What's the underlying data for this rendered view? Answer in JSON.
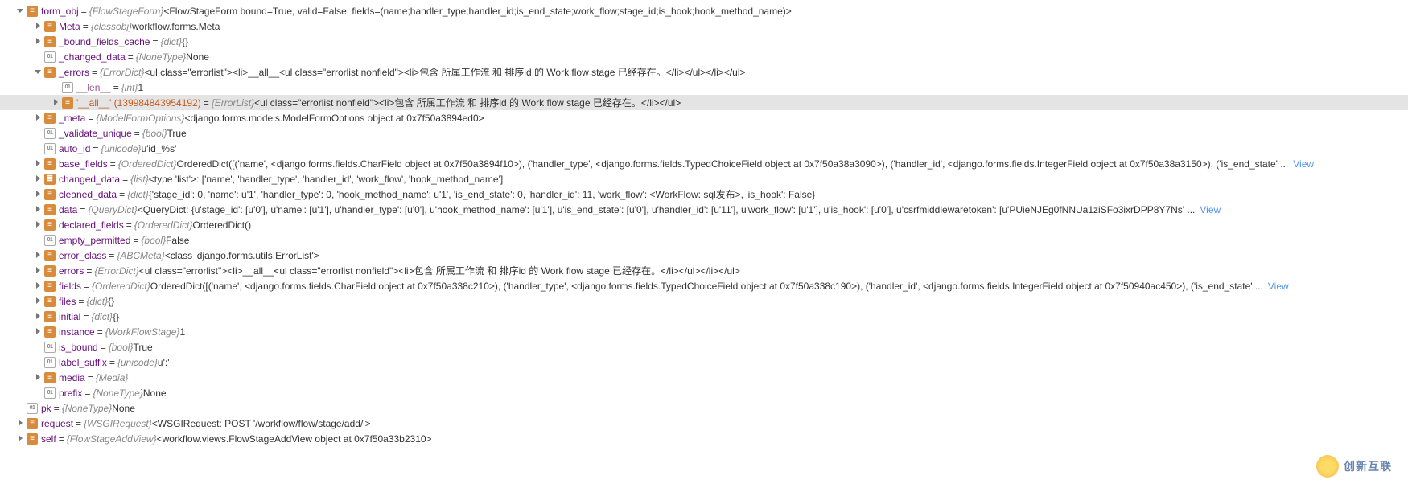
{
  "view_link": "View",
  "watermark": "创新互联",
  "rows": [
    {
      "indent": 0,
      "arrow": "exp",
      "icon": "obj",
      "nameClass": "name",
      "name": "form_obj",
      "type": "{FlowStageForm}",
      "val": "<FlowStageForm bound=True, valid=False, fields=(name;handler_type;handler_id;is_end_state;work_flow;stage_id;is_hook;hook_method_name)>"
    },
    {
      "indent": 1,
      "arrow": "col",
      "icon": "obj",
      "nameClass": "name",
      "name": "Meta",
      "type": "{classobj}",
      "val": "workflow.forms.Meta"
    },
    {
      "indent": 1,
      "arrow": "col",
      "icon": "obj",
      "nameClass": "name",
      "name": "_bound_fields_cache",
      "type": "{dict}",
      "val": "{}"
    },
    {
      "indent": 1,
      "arrow": "none",
      "icon": "box",
      "nameClass": "name",
      "name": "_changed_data",
      "type": "{NoneType}",
      "val": "None"
    },
    {
      "indent": 1,
      "arrow": "exp",
      "icon": "obj",
      "nameClass": "name",
      "name": "_errors",
      "type": "{ErrorDict}",
      "val": "<ul class=\"errorlist\"><li>__all__<ul class=\"errorlist nonfield\"><li>包含 所属工作流 和 排序id 的 Work flow stage 已经存在。</li></ul></li></ul>"
    },
    {
      "indent": 2,
      "arrow": "none",
      "icon": "box",
      "nameClass": "name special",
      "name": "__len__",
      "type": "{int}",
      "val": "1"
    },
    {
      "indent": 2,
      "arrow": "col",
      "icon": "obj",
      "nameClass": "name orange",
      "name": "'__all__' (139984843954192)",
      "type": "{ErrorList}",
      "val": "<ul class=\"errorlist nonfield\"><li>包含 所属工作流 和 排序id 的 Work flow stage 已经存在。</li></ul>",
      "sel": true
    },
    {
      "indent": 1,
      "arrow": "col",
      "icon": "obj",
      "nameClass": "name",
      "name": "_meta",
      "type": "{ModelFormOptions}",
      "val": "<django.forms.models.ModelFormOptions object at 0x7f50a3894ed0>"
    },
    {
      "indent": 1,
      "arrow": "none",
      "icon": "box",
      "nameClass": "name",
      "name": "_validate_unique",
      "type": "{bool}",
      "val": "True"
    },
    {
      "indent": 1,
      "arrow": "none",
      "icon": "box",
      "nameClass": "name",
      "name": "auto_id",
      "type": "{unicode}",
      "val": "u'id_%s'"
    },
    {
      "indent": 1,
      "arrow": "col",
      "icon": "obj",
      "nameClass": "name",
      "name": "base_fields",
      "type": "{OrderedDict}",
      "val": "OrderedDict([('name', <django.forms.fields.CharField object at 0x7f50a3894f10>), ('handler_type', <django.forms.fields.TypedChoiceField object at 0x7f50a38a3090>), ('handler_id', <django.forms.fields.IntegerField object at 0x7f50a38a3150>), ('is_end_state' ...",
      "view": true
    },
    {
      "indent": 1,
      "arrow": "col",
      "icon": "list",
      "nameClass": "name",
      "name": "changed_data",
      "type": "{list}",
      "val": "<type 'list'>: ['name', 'handler_type', 'handler_id', 'work_flow', 'hook_method_name']"
    },
    {
      "indent": 1,
      "arrow": "col",
      "icon": "obj",
      "nameClass": "name",
      "name": "cleaned_data",
      "type": "{dict}",
      "val": "{'stage_id': 0, 'name': u'1', 'handler_type': 0, 'hook_method_name': u'1', 'is_end_state': 0, 'handler_id': 11, 'work_flow': <WorkFlow: sql发布>, 'is_hook': False}"
    },
    {
      "indent": 1,
      "arrow": "col",
      "icon": "obj",
      "nameClass": "name",
      "name": "data",
      "type": "{QueryDict}",
      "val": "<QueryDict: {u'stage_id': [u'0'], u'name': [u'1'], u'handler_type': [u'0'], u'hook_method_name': [u'1'], u'is_end_state': [u'0'], u'handler_id': [u'11'], u'work_flow': [u'1'], u'is_hook': [u'0'], u'csrfmiddlewaretoken': [u'PUieNJEg0fNNUa1ziSFo3ixrDPP8Y7Ns' ...",
      "view": true
    },
    {
      "indent": 1,
      "arrow": "col",
      "icon": "obj",
      "nameClass": "name",
      "name": "declared_fields",
      "type": "{OrderedDict}",
      "val": "OrderedDict()"
    },
    {
      "indent": 1,
      "arrow": "none",
      "icon": "box",
      "nameClass": "name",
      "name": "empty_permitted",
      "type": "{bool}",
      "val": "False"
    },
    {
      "indent": 1,
      "arrow": "col",
      "icon": "obj",
      "nameClass": "name",
      "name": "error_class",
      "type": "{ABCMeta}",
      "val": "<class 'django.forms.utils.ErrorList'>"
    },
    {
      "indent": 1,
      "arrow": "col",
      "icon": "obj",
      "nameClass": "name",
      "name": "errors",
      "type": "{ErrorDict}",
      "val": "<ul class=\"errorlist\"><li>__all__<ul class=\"errorlist nonfield\"><li>包含 所属工作流 和 排序id 的 Work flow stage 已经存在。</li></ul></li></ul>"
    },
    {
      "indent": 1,
      "arrow": "col",
      "icon": "obj",
      "nameClass": "name",
      "name": "fields",
      "type": "{OrderedDict}",
      "val": "OrderedDict([('name', <django.forms.fields.CharField object at 0x7f50a338c210>), ('handler_type', <django.forms.fields.TypedChoiceField object at 0x7f50a338c190>), ('handler_id', <django.forms.fields.IntegerField object at 0x7f50940ac450>), ('is_end_state' ...",
      "view": true
    },
    {
      "indent": 1,
      "arrow": "col",
      "icon": "obj",
      "nameClass": "name",
      "name": "files",
      "type": "{dict}",
      "val": "{}"
    },
    {
      "indent": 1,
      "arrow": "col",
      "icon": "obj",
      "nameClass": "name",
      "name": "initial",
      "type": "{dict}",
      "val": "{}"
    },
    {
      "indent": 1,
      "arrow": "col",
      "icon": "obj",
      "nameClass": "name",
      "name": "instance",
      "type": "{WorkFlowStage}",
      "val": "1"
    },
    {
      "indent": 1,
      "arrow": "none",
      "icon": "box",
      "nameClass": "name",
      "name": "is_bound",
      "type": "{bool}",
      "val": "True"
    },
    {
      "indent": 1,
      "arrow": "none",
      "icon": "box",
      "nameClass": "name",
      "name": "label_suffix",
      "type": "{unicode}",
      "val": "u':'"
    },
    {
      "indent": 1,
      "arrow": "col",
      "icon": "obj",
      "nameClass": "name",
      "name": "media",
      "type": "{Media}",
      "val": ""
    },
    {
      "indent": 1,
      "arrow": "none",
      "icon": "box",
      "nameClass": "name",
      "name": "prefix",
      "type": "{NoneType}",
      "val": "None"
    },
    {
      "indent": 0,
      "arrow": "none",
      "icon": "box",
      "nameClass": "name",
      "name": "pk",
      "type": "{NoneType}",
      "val": "None"
    },
    {
      "indent": 0,
      "arrow": "col",
      "icon": "obj",
      "nameClass": "name",
      "name": "request",
      "type": "{WSGIRequest}",
      "val": "<WSGIRequest: POST '/workflow/flow/stage/add/'>"
    },
    {
      "indent": 0,
      "arrow": "col",
      "icon": "obj",
      "nameClass": "name",
      "name": "self",
      "type": "{FlowStageAddView}",
      "val": "<workflow.views.FlowStageAddView object at 0x7f50a33b2310>"
    }
  ]
}
